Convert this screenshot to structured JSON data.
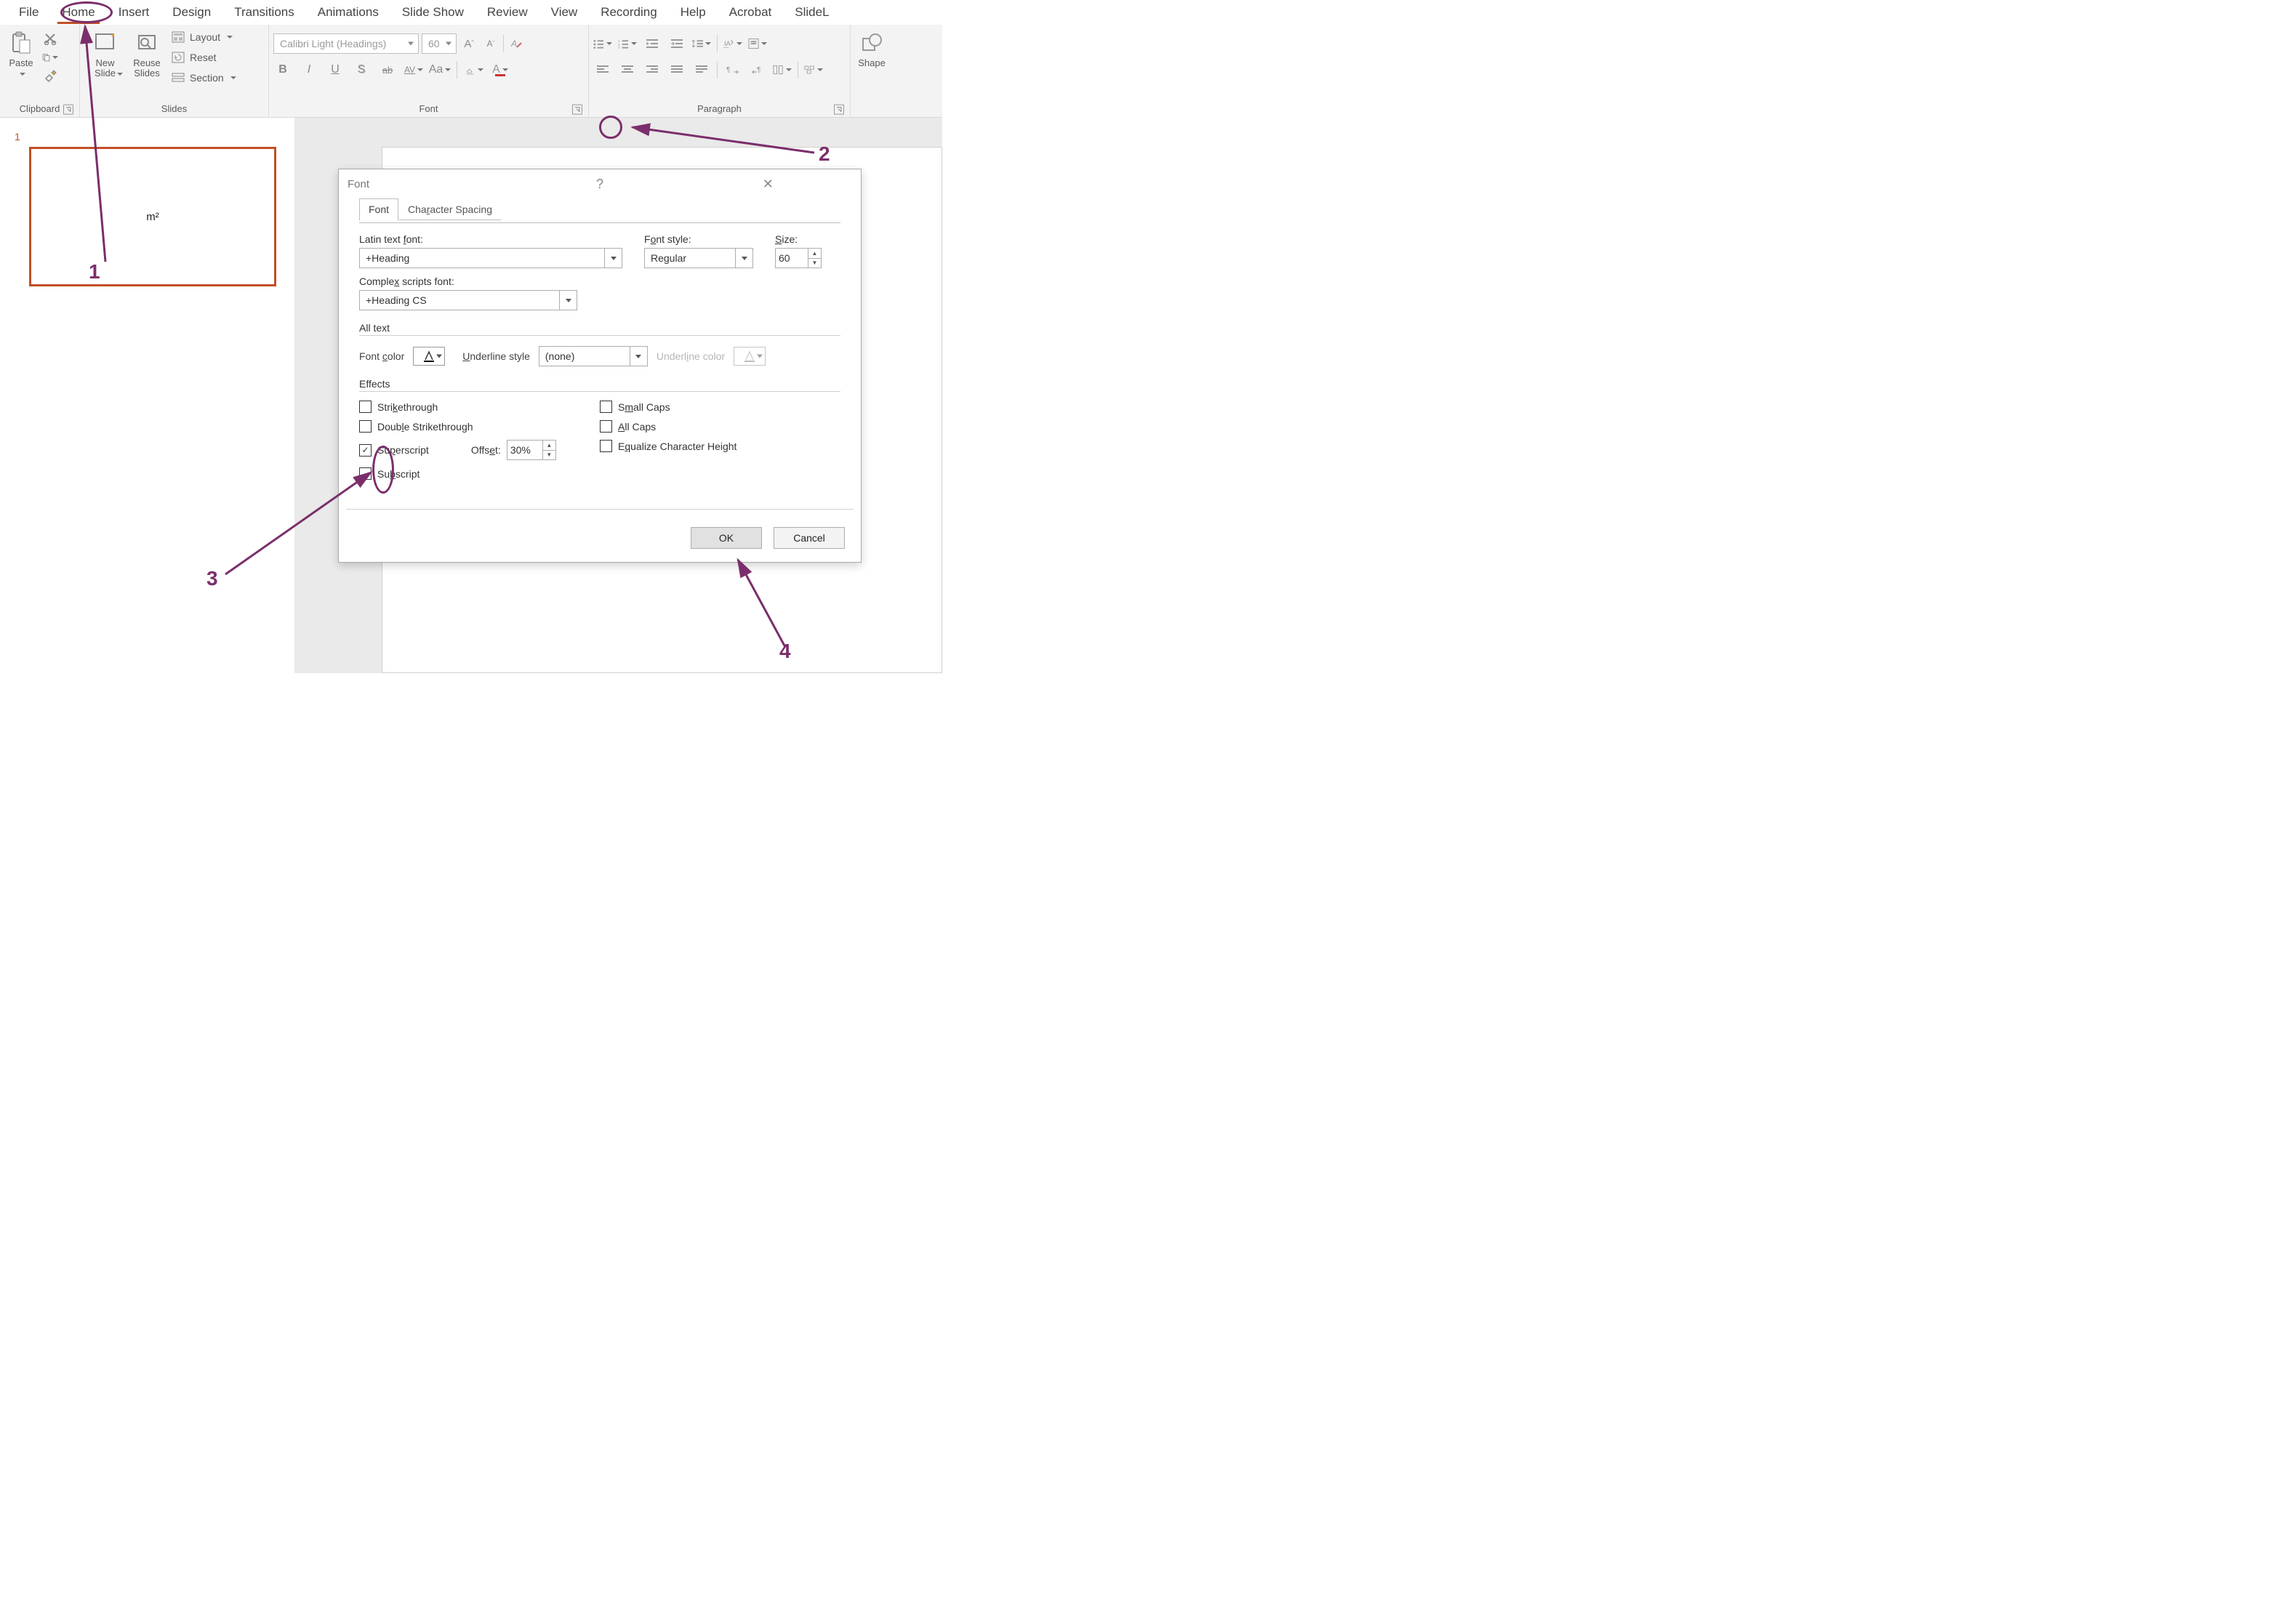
{
  "ribbon": {
    "tabs": [
      "File",
      "Home",
      "Insert",
      "Design",
      "Transitions",
      "Animations",
      "Slide Show",
      "Review",
      "View",
      "Recording",
      "Help",
      "Acrobat",
      "SlideL"
    ],
    "active_tab_index": 1,
    "groups": {
      "clipboard": {
        "label": "Clipboard",
        "paste": "Paste"
      },
      "slides": {
        "label": "Slides",
        "new_slide": "New Slide",
        "reuse_slides": "Reuse Slides",
        "layout": "Layout",
        "reset": "Reset",
        "section": "Section"
      },
      "font": {
        "label": "Font",
        "font_combo": "Calibri Light (Headings)",
        "size_combo": "60",
        "bold": "B",
        "italic": "I",
        "underline": "U",
        "shadow": "S",
        "strike": "ab",
        "char_spacing": "AV",
        "change_case": "Aa"
      },
      "paragraph": {
        "label": "Paragraph"
      },
      "drawing": {
        "label": "",
        "shapes": "Shape"
      }
    }
  },
  "slidepanel": {
    "slide_number": "1",
    "slide_text": "m²"
  },
  "dialog": {
    "title": "Font",
    "tabs": {
      "font": "Font",
      "spacing": "Character Spacing"
    },
    "labels": {
      "latin_font": "Latin text font:",
      "font_style": "Font style:",
      "size": "Size:",
      "complex_font": "Complex scripts font:",
      "all_text": "All text",
      "font_color": "Font color",
      "underline_style": "Underline style",
      "underline_color": "Underline color",
      "effects": "Effects",
      "offset": "Offset:"
    },
    "values": {
      "latin_font": "+Heading",
      "font_style": "Regular",
      "size": "60",
      "complex_font": "+Heading CS",
      "underline_style": "(none)",
      "offset": "30%"
    },
    "effects": {
      "strikethrough": "Strikethrough",
      "double_strike": "Double Strikethrough",
      "superscript": "Superscript",
      "subscript": "Subscript",
      "small_caps": "Small Caps",
      "all_caps": "All Caps",
      "equalize": "Equalize Character Height"
    },
    "checked": {
      "superscript": true
    },
    "buttons": {
      "ok": "OK",
      "cancel": "Cancel"
    },
    "help": "?",
    "close": "✕"
  },
  "annotations": {
    "n1": "1",
    "n2": "2",
    "n3": "3",
    "n4": "4"
  },
  "colors": {
    "annotation": "#7b2e6b",
    "accent": "#c14f24"
  }
}
